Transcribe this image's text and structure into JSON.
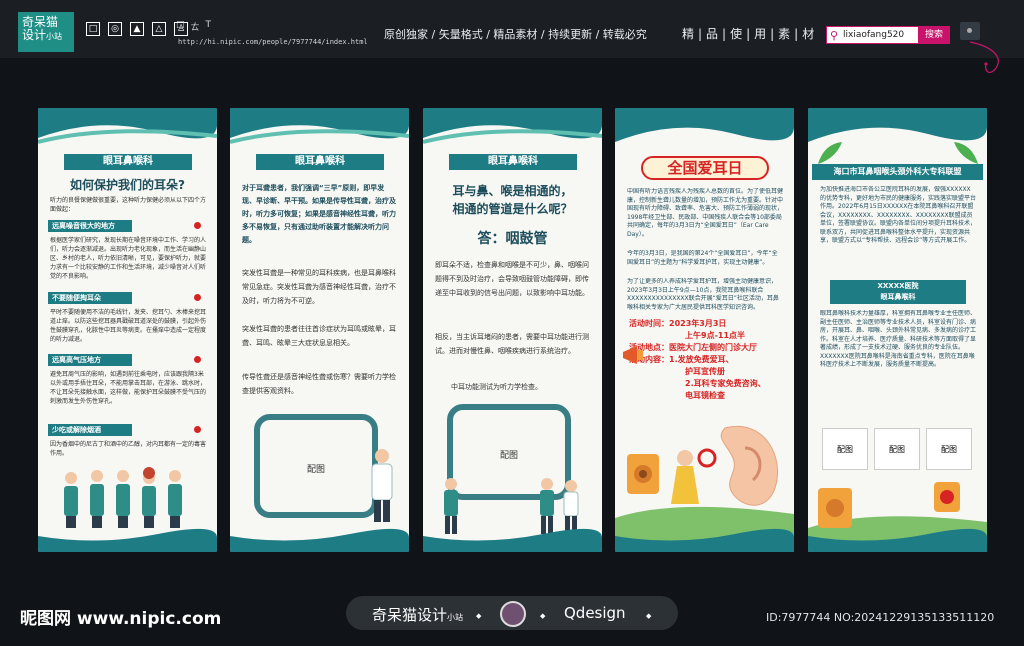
{
  "header": {
    "logo_line1": "奇呆猫",
    "logo_line2": "设计",
    "logo_sub": "小站",
    "tools": [
      "□",
      "ㄊ",
      "T"
    ],
    "url": "http://hi.nipic.com/people/7977744/index.html",
    "slogans": "原创独家 / 矢量格式 / 精品素材 / 持续更新 / 转载必究",
    "jingpin": "精|品|使|用|素|材",
    "search_value": "lixiaofang520",
    "search_button": "搜索"
  },
  "panel1": {
    "ribbon": "眼耳鼻喉科",
    "title": "如何保护我们的耳朵?",
    "intro": "听力的良餐保健做很重要，这种听力保健必须从以下四个方面做起：",
    "sections": [
      {
        "label": "远离噪音很大的地方",
        "text": "根据医学家们研究，发现长期在噪音环境中工作、学习的人们，听力会逐渐减退。出现听力老化现象，而生活在幽静山区、乡村的老人，听力依旧清晰，可见，要保护听力，就要力求有一个比较安静的工作和生活环境，减少噪音对人们听觉的不良影响。"
      },
      {
        "label": "不要随便掏耳朵",
        "text": "平时不要随便用不洁的毛线针，发夹、挖耳勺、木棒来挖耳道止痒。以防这些挖耳器具戳破耳道深处的鼓膜，引起外伤性鼓膜穿孔，化脓性中耳炎等病变。在搔痒中造成一定程度的听力减退。"
      },
      {
        "label": "远离高气压地方",
        "text": "避免耳周气压的影响，如遇到前往乘电时，应该跟我隔3米以外或用手捂住耳朵，不能用掌击耳部，在游泳、跳水时，不让耳朵先接触水面，这样做，能保护耳朵鼓膜不受气压的刺激而发生外伤性穿孔。"
      },
      {
        "label": "少吃或解除烟酒",
        "text": "因为香烟中的尼古丁和酒中的乙醇，对内耳都有一定的毒害作用。"
      }
    ]
  },
  "panel2": {
    "ribbon": "眼耳鼻喉科",
    "bold_text": "对于耳聋患者，我们强调“三早”原则，即早发现、早诊断、早干预。如果是传导性耳聋，治疗及时，听力多可恢复；如果是感音神经性耳聋，听力多不易恢复，只有通过助听装置才能解决听力问题。",
    "paragraphs": [
      "突发性耳聋是一种常见的耳科疾病，也是耳鼻喉科常见急症。突发性耳聋为感音神经性耳聋，治疗不及时，听力将为不可逆。",
      "突发性耳聋的患者往往首诊症状为耳鸣或眩晕，耳聋、耳鸣、眩晕三大症状息息相关。",
      "传导性聋还是感音神经性聋或伤寒？需要听力学检查提供客观资料。"
    ],
    "placeholder": "配图"
  },
  "panel3": {
    "ribbon": "眼耳鼻喉科",
    "title_line1": "耳与鼻、喉是相通的，",
    "title_line2": "相通的管道是什么呢？",
    "answer": "答：咽鼓管",
    "paragraphs": [
      "即耳朵不适，检查鼻和咽喉是不可少，鼻、咽喉问题得不到及时治疗，会导致咽鼓管功能障碍，即传递至中耳收到的信号出问题，以致影响中耳功能。",
      "相反，当主诉耳堵闷的患者，需要中耳功能进行测试。进而对慢性鼻、咽喉疾病进行系统治疗。",
      "中耳功能测试为听力学检查。"
    ],
    "placeholder": "配图"
  },
  "panel4": {
    "title": "全国爱耳日",
    "intro1": "中国有听力语言残疾人为残疾人总数的首位。为了使低耳健康，控制新生聋儿数量的增加，预防工作尤为重要。针对中国现有听力障碍、致聋率、危害大、预防工作薄弱的现状，1998年经卫生部、民政部、中国残疾人联合会等10部委局共同确定，每年的3月3日为“全国爱耳日”（Ear Care Day）。",
    "intro2": "今年的3月3日，是我国的第24个“全国爱耳日”，今年“全国爱耳日”的主题为“科学爱耳护耳，实现主动健康”。",
    "intro3": "为了让更多的人养成科学爱耳护耳，增强主动健康意识，2023年3月3日上午9点—10点，我院耳鼻喉科联合XXXXXXXXXXXXXXX联合开展“爱耳日”社区活动，耳鼻喉科相关专家为广大居民提供耳科医学知识咨询。",
    "event_time_label": "活动时间：",
    "event_time": "2023年3月3日",
    "event_time2": "上午9点-11点半",
    "event_place_label": "活动地点：",
    "event_place": "医院大门左侧的门诊大厅",
    "event_content_label": "活动内容：",
    "event_items": [
      "1.发放免费爱耳、",
      "护耳宣传册",
      "2.耳科专家免费咨询、",
      "电耳镜检查"
    ]
  },
  "panel5": {
    "title": "海口市耳鼻咽喉头颈外科大专科联盟",
    "intro": "为加快推进海口市各公立医院耳科的发展，做强XXXXXX的优势专科，更好地为市民的健康服务，实践落实联盟平台作用。2022年6月15日XXXXXX在本院耳鼻喉科召开联盟会议，XXXXXXXX、XXXXXXXX、XXXXXXXX联盟成员单位，签署联盟协议。联盟内各单位间分项提升耳科技术，联系双方，共同促进耳鼻喉科整体水平提升，实现资源共享，联盟方式以“专科帮扶、远程会诊”等方式开展工作。",
    "hospital": "XXXXX医院",
    "dept": "眼耳鼻喉科",
    "body": "眼耳鼻喉科技术力量雄厚，科室拥有耳鼻喉专业主任医师、副主任医师、主治医师等专业技术人员，科室设有门诊、病房，开展耳、鼻、咽喉、头颈外科常见病、多发病的诊疗工作。科室在人才培养、医疗质量、科研技术等方面取得了显著成绩，形成了一支技术过硬、服务优良的专业队伍。XXXXXXX医院耳鼻喉科是海南省重点专科，医院在耳鼻喉科医疗技术上不断发展，服务质量不断提高。",
    "placeholders": [
      "配图",
      "配图",
      "配图"
    ]
  },
  "footer": {
    "logo": "昵图网 www.nipic.com",
    "brand": "奇呆猫设计",
    "brand_sub": "小站",
    "qdesign": "Qdesign",
    "id": "ID:7977744 NO:20241229135133511120"
  },
  "colors": {
    "teal": "#1e7c84",
    "dark_teal": "#1e4e5c",
    "red": "#d62424",
    "magenta": "#c9136a"
  }
}
